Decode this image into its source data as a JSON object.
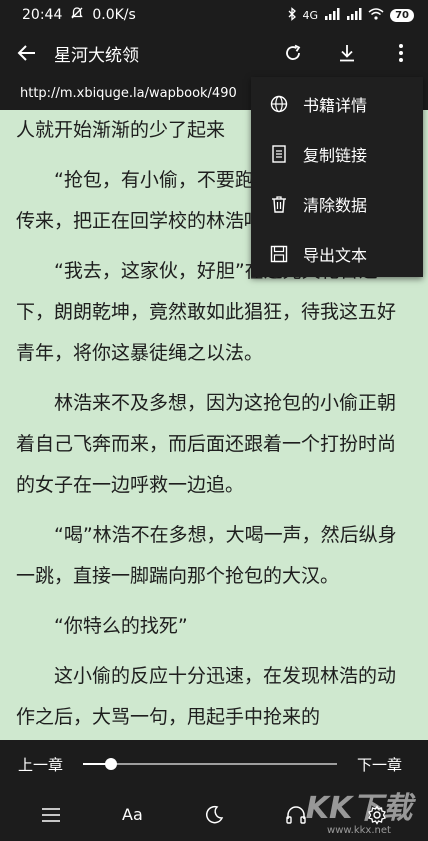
{
  "status": {
    "time": "20:44",
    "speed": "0.0K/s",
    "signal": "4G",
    "battery": "70"
  },
  "toolbar": {
    "title": "星河大统领"
  },
  "url": "http://m.xbiquge.la/wapbook/490",
  "menu": {
    "items": [
      {
        "label": "书籍详情",
        "icon": "globe-icon"
      },
      {
        "label": "复制链接",
        "icon": "document-icon"
      },
      {
        "label": "清除数据",
        "icon": "trash-icon"
      },
      {
        "label": "导出文本",
        "icon": "save-icon"
      }
    ]
  },
  "content": {
    "paragraphs": [
      "人就开始渐渐的少了起来",
      "“抢包，有小偷，不要跑”一道女子的呼声传来，把正在回学校的林浩吓得身一颤。",
      "“我去，这家伙，好胆”在这光天化日之下，朗朗乾坤，竟然敢如此猖狂，待我这五好青年，将你这暴徒绳之以法。",
      "林浩来不及多想，因为这抢包的小偷正朝着自己飞奔而来，而后面还跟着一个打扮时尚的女子在一边呼救一边追。",
      "“喝”林浩不在多想，大喝一声，然后纵身一跳，直接一脚踹向那个抢包的大汉。",
      "“你特么的找死”",
      "这小偷的反应十分迅速，在发现林浩的动作之后，大骂一句，甩起手中抢来的"
    ]
  },
  "reader": {
    "prev_chapter": "上一章",
    "next_chapter": "下一章",
    "progress": 0.11
  },
  "tools": {
    "font_label": "Aa"
  },
  "watermark": {
    "logo": "KK下载",
    "site": "www.kkx.net"
  }
}
